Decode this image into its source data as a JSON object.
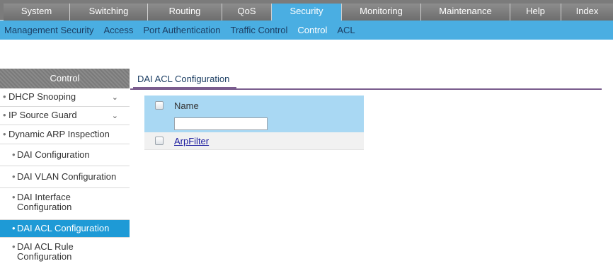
{
  "topnav": [
    {
      "label": "System",
      "active": false
    },
    {
      "label": "Switching",
      "active": false
    },
    {
      "label": "Routing",
      "active": false
    },
    {
      "label": "QoS",
      "active": false
    },
    {
      "label": "Security",
      "active": true
    },
    {
      "label": "Monitoring",
      "active": false
    },
    {
      "label": "Maintenance",
      "active": false
    },
    {
      "label": "Help",
      "active": false
    },
    {
      "label": "Index",
      "active": false
    }
  ],
  "subnav": [
    {
      "label": "Management Security",
      "active": false
    },
    {
      "label": "Access",
      "active": false
    },
    {
      "label": "Port Authentication",
      "active": false
    },
    {
      "label": "Traffic Control",
      "active": false
    },
    {
      "label": "Control",
      "active": true
    },
    {
      "label": "ACL",
      "active": false
    }
  ],
  "sidebar": {
    "header": "Control",
    "items": [
      {
        "label": "DHCP Snooping",
        "chevron": "down"
      },
      {
        "label": "IP Source Guard",
        "chevron": "down"
      },
      {
        "label": "Dynamic ARP Inspection",
        "chevron": "up"
      },
      {
        "label": "DAI Configuration"
      },
      {
        "label": "DAI VLAN Configuration"
      },
      {
        "label": "DAI Interface Configuration"
      },
      {
        "label": "DAI ACL Configuration",
        "active": true
      },
      {
        "label": "DAI ACL Rule Configuration"
      }
    ],
    "bullet": "•",
    "chevron_down": "⌄",
    "chevron_up": "⌃"
  },
  "main": {
    "title": "DAI ACL Configuration",
    "table": {
      "name_header": "Name",
      "filter_value": "",
      "rows": [
        {
          "name": "ArpFilter"
        }
      ]
    }
  },
  "colors": {
    "accent": "#4aaee2",
    "active_sidebar": "#1e9ad6",
    "table_header": "#a9d8f3",
    "title_rule": "#7a5c8e"
  }
}
